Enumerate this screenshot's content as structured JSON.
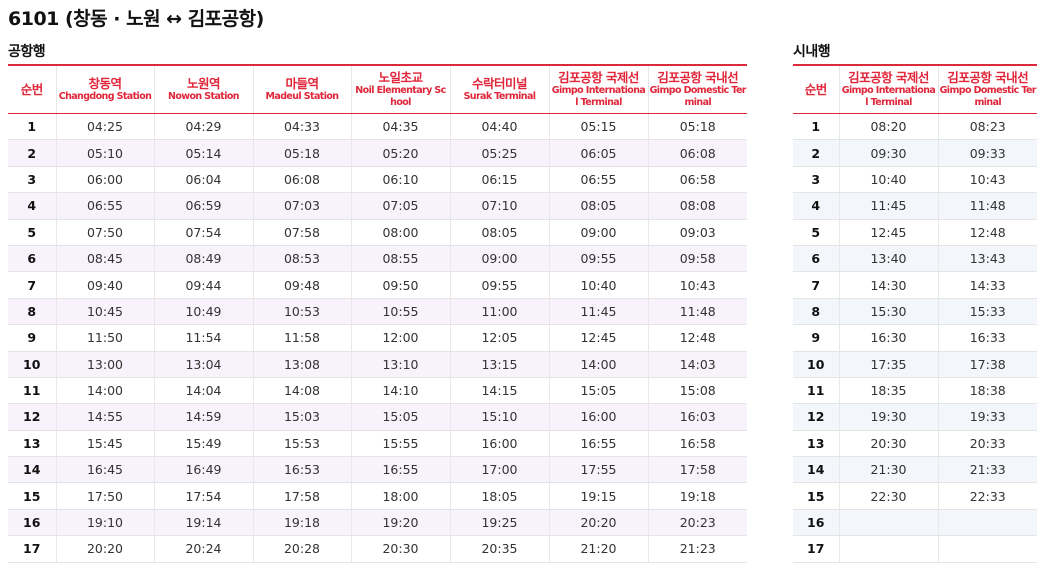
{
  "page_title": "6101 (창동 · 노원 ↔ 김포공항)",
  "airport_bound": {
    "title": "공항행",
    "headers": [
      {
        "ko": "순번",
        "en": ""
      },
      {
        "ko": "창동역",
        "en": "Changdong Station"
      },
      {
        "ko": "노원역",
        "en": "Nowon Station"
      },
      {
        "ko": "마들역",
        "en": "Madeul Station"
      },
      {
        "ko": "노일초교",
        "en": "Noil Elementary School"
      },
      {
        "ko": "수락터미널",
        "en": "Surak Terminal"
      },
      {
        "ko": "김포공항 국제선",
        "en": "Gimpo International Terminal"
      },
      {
        "ko": "김포공항 국내선",
        "en": "Gimpo Domestic Terminal"
      }
    ],
    "rows": [
      [
        "1",
        "04:25",
        "04:29",
        "04:33",
        "04:35",
        "04:40",
        "05:15",
        "05:18"
      ],
      [
        "2",
        "05:10",
        "05:14",
        "05:18",
        "05:20",
        "05:25",
        "06:05",
        "06:08"
      ],
      [
        "3",
        "06:00",
        "06:04",
        "06:08",
        "06:10",
        "06:15",
        "06:55",
        "06:58"
      ],
      [
        "4",
        "06:55",
        "06:59",
        "07:03",
        "07:05",
        "07:10",
        "08:05",
        "08:08"
      ],
      [
        "5",
        "07:50",
        "07:54",
        "07:58",
        "08:00",
        "08:05",
        "09:00",
        "09:03"
      ],
      [
        "6",
        "08:45",
        "08:49",
        "08:53",
        "08:55",
        "09:00",
        "09:55",
        "09:58"
      ],
      [
        "7",
        "09:40",
        "09:44",
        "09:48",
        "09:50",
        "09:55",
        "10:40",
        "10:43"
      ],
      [
        "8",
        "10:45",
        "10:49",
        "10:53",
        "10:55",
        "11:00",
        "11:45",
        "11:48"
      ],
      [
        "9",
        "11:50",
        "11:54",
        "11:58",
        "12:00",
        "12:05",
        "12:45",
        "12:48"
      ],
      [
        "10",
        "13:00",
        "13:04",
        "13:08",
        "13:10",
        "13:15",
        "14:00",
        "14:03"
      ],
      [
        "11",
        "14:00",
        "14:04",
        "14:08",
        "14:10",
        "14:15",
        "15:05",
        "15:08"
      ],
      [
        "12",
        "14:55",
        "14:59",
        "15:03",
        "15:05",
        "15:10",
        "16:00",
        "16:03"
      ],
      [
        "13",
        "15:45",
        "15:49",
        "15:53",
        "15:55",
        "16:00",
        "16:55",
        "16:58"
      ],
      [
        "14",
        "16:45",
        "16:49",
        "16:53",
        "16:55",
        "17:00",
        "17:55",
        "17:58"
      ],
      [
        "15",
        "17:50",
        "17:54",
        "17:58",
        "18:00",
        "18:05",
        "19:15",
        "19:18"
      ],
      [
        "16",
        "19:10",
        "19:14",
        "19:18",
        "19:20",
        "19:25",
        "20:20",
        "20:23"
      ],
      [
        "17",
        "20:20",
        "20:24",
        "20:28",
        "20:30",
        "20:35",
        "21:20",
        "21:23"
      ]
    ]
  },
  "city_bound": {
    "title": "시내행",
    "headers": [
      {
        "ko": "순번",
        "en": ""
      },
      {
        "ko": "김포공항 국제선",
        "en": "Gimpo International Terminal"
      },
      {
        "ko": "김포공항 국내선",
        "en": "Gimpo Domestic Terminal"
      }
    ],
    "rows": [
      [
        "1",
        "08:20",
        "08:23"
      ],
      [
        "2",
        "09:30",
        "09:33"
      ],
      [
        "3",
        "10:40",
        "10:43"
      ],
      [
        "4",
        "11:45",
        "11:48"
      ],
      [
        "5",
        "12:45",
        "12:48"
      ],
      [
        "6",
        "13:40",
        "13:43"
      ],
      [
        "7",
        "14:30",
        "14:33"
      ],
      [
        "8",
        "15:30",
        "15:33"
      ],
      [
        "9",
        "16:30",
        "16:33"
      ],
      [
        "10",
        "17:35",
        "17:38"
      ],
      [
        "11",
        "18:35",
        "18:38"
      ],
      [
        "12",
        "19:30",
        "19:33"
      ],
      [
        "13",
        "20:30",
        "20:33"
      ],
      [
        "14",
        "21:30",
        "21:33"
      ],
      [
        "15",
        "22:30",
        "22:33"
      ],
      [
        "16",
        "",
        ""
      ],
      [
        "17",
        "",
        ""
      ]
    ]
  },
  "colors": {
    "accent": "#e0263a",
    "row_stripe_airport": "#f7f2fb",
    "row_stripe_city": "#f3f6fb"
  }
}
